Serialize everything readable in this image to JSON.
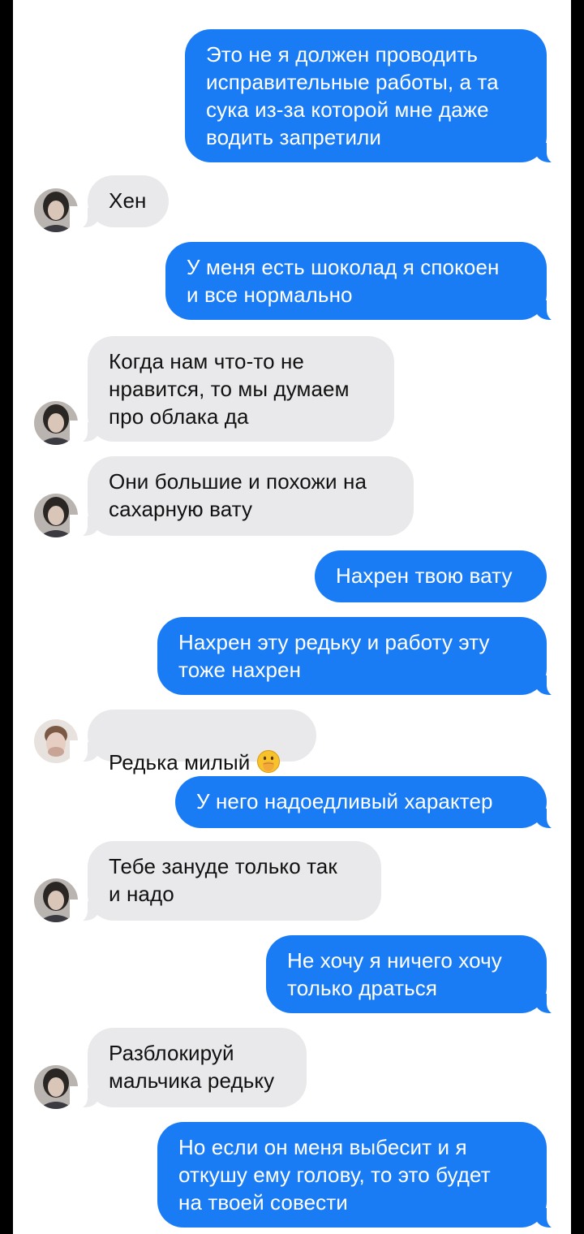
{
  "messages": [
    {
      "dir": "out",
      "text": "Это не я должен проводить\nисправительные работы, а та\nсука из-за которой мне даже\nводить запретили"
    },
    {
      "dir": "in",
      "text": "Хен"
    },
    {
      "dir": "out",
      "text": "У меня есть шоколад я спокоен\nи все нормально"
    },
    {
      "dir": "in",
      "text": "Когда нам что-то не\nнравится, то мы думаем\nпро облака да"
    },
    {
      "dir": "in",
      "text": "Они большие и похожи на\nсахарную вату"
    },
    {
      "dir": "out",
      "text": "Нахрен твою вату"
    },
    {
      "dir": "out",
      "text": "Нахрен эту редьку и работу эту\nтоже нахрен"
    },
    {
      "dir": "in",
      "text": "Редька милый",
      "emoji": "face-with-hand-over-mouth-icon"
    },
    {
      "dir": "out",
      "text": "У него надоедливый характер"
    },
    {
      "dir": "in",
      "text": "Тебе зануде только так\nи надо"
    },
    {
      "dir": "out",
      "text": "Не хочу я ничего хочу\nтолько драться"
    },
    {
      "dir": "in",
      "text": "Разблокируй\nмальчика редьку"
    },
    {
      "dir": "out",
      "text": "Но если он меня выбесит и я\nоткушу ему голову, то это будет\nна твоей совести"
    }
  ],
  "colors": {
    "outgoing_bubble": "#1a7cf5",
    "incoming_bubble": "#e9e9eb",
    "background": "#ffffff"
  }
}
